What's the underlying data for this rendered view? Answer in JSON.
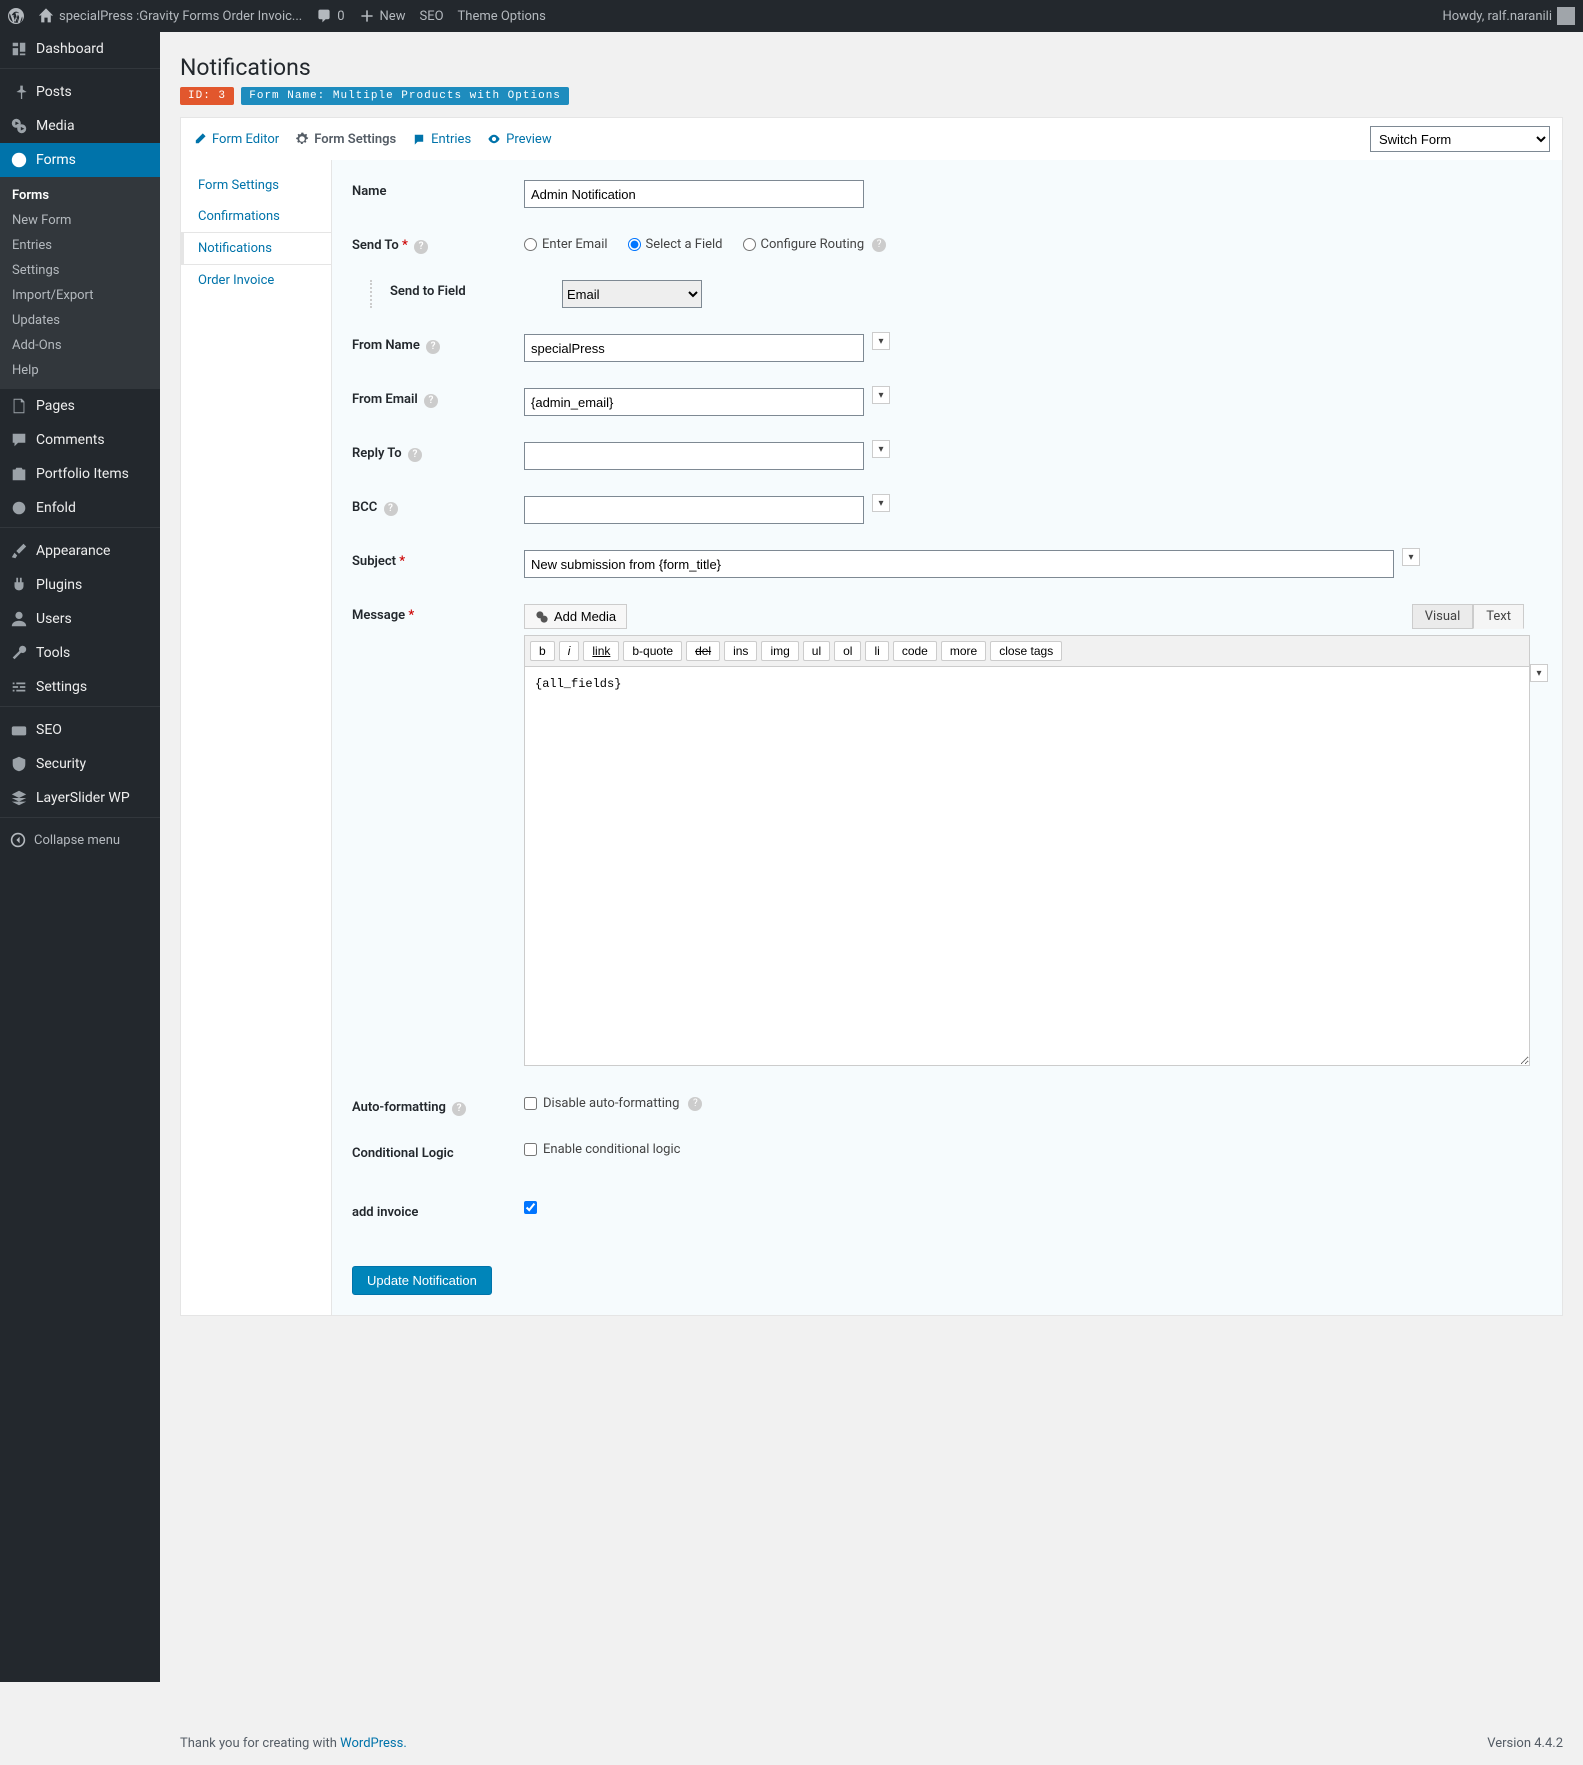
{
  "adminbar": {
    "site_title": "specialPress :Gravity Forms Order Invoic...",
    "comments": "0",
    "new": "New",
    "seo": "SEO",
    "theme_options": "Theme Options",
    "howdy": "Howdy, ralf.naranili"
  },
  "sidebar": {
    "dashboard": "Dashboard",
    "posts": "Posts",
    "media": "Media",
    "forms": "Forms",
    "pages": "Pages",
    "comments": "Comments",
    "portfolio": "Portfolio Items",
    "enfold": "Enfold",
    "appearance": "Appearance",
    "plugins": "Plugins",
    "users": "Users",
    "tools": "Tools",
    "settings": "Settings",
    "seo": "SEO",
    "security": "Security",
    "layerslider": "LayerSlider WP",
    "collapse": "Collapse menu",
    "forms_sub": {
      "forms": "Forms",
      "new_form": "New Form",
      "entries": "Entries",
      "settings": "Settings",
      "import_export": "Import/Export",
      "updates": "Updates",
      "addons": "Add-Ons",
      "help": "Help"
    }
  },
  "page": {
    "title": "Notifications",
    "id_badge": "ID: 3",
    "form_badge": "Form Name: Multiple Products with Options"
  },
  "toolbar": {
    "form_editor": "Form Editor",
    "form_settings": "Form Settings",
    "entries": "Entries",
    "preview": "Preview",
    "switch_form": "Switch Form"
  },
  "settings_nav": {
    "form_settings": "Form Settings",
    "confirmations": "Confirmations",
    "notifications": "Notifications",
    "order_invoice": "Order Invoice"
  },
  "form": {
    "name_label": "Name",
    "name_value": "Admin Notification",
    "sendto_label": "Send To",
    "sendto_enter_email": "Enter Email",
    "sendto_select_field": "Select a Field",
    "sendto_configure_routing": "Configure Routing",
    "send_to_field_label": "Send to Field",
    "send_to_field_value": "Email",
    "from_name_label": "From Name",
    "from_name_value": "specialPress",
    "from_email_label": "From Email",
    "from_email_value": "{admin_email}",
    "reply_to_label": "Reply To",
    "reply_to_value": "",
    "bcc_label": "BCC",
    "bcc_value": "",
    "subject_label": "Subject",
    "subject_value": "New submission from {form_title}",
    "message_label": "Message",
    "add_media": "Add Media",
    "tab_visual": "Visual",
    "tab_text": "Text",
    "ed": {
      "b": "b",
      "i": "i",
      "link": "link",
      "bquote": "b-quote",
      "del": "del",
      "ins": "ins",
      "img": "img",
      "ul": "ul",
      "ol": "ol",
      "li": "li",
      "code": "code",
      "more": "more",
      "close": "close tags"
    },
    "message_value": "{all_fields}",
    "autoformat_label": "Auto-formatting",
    "autoformat_checkbox": "Disable auto-formatting",
    "conditional_label": "Conditional Logic",
    "conditional_checkbox": "Enable conditional logic",
    "add_invoice_label": "add invoice",
    "submit": "Update Notification"
  },
  "footer": {
    "thanks_pre": "Thank you for creating with ",
    "thanks_link": "WordPress.",
    "version": "Version 4.4.2"
  }
}
